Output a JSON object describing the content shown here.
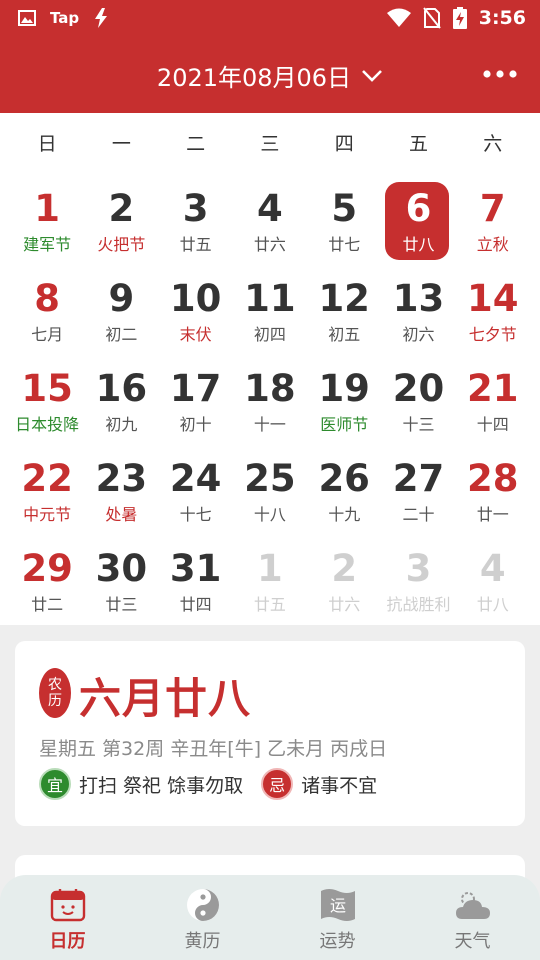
{
  "status_bar": {
    "carrier_label": "Tap",
    "time": "3:56"
  },
  "header": {
    "date_label": "2021年08月06日"
  },
  "weekdays": [
    "日",
    "一",
    "二",
    "三",
    "四",
    "五",
    "六"
  ],
  "calendar": {
    "weeks": [
      [
        {
          "day": "1",
          "sub": "建军节",
          "weekend": true,
          "sub_style": "green"
        },
        {
          "day": "2",
          "sub": "火把节",
          "weekend": false,
          "sub_style": "red"
        },
        {
          "day": "3",
          "sub": "廿五",
          "weekend": false,
          "sub_style": ""
        },
        {
          "day": "4",
          "sub": "廿六",
          "weekend": false,
          "sub_style": ""
        },
        {
          "day": "5",
          "sub": "廿七",
          "weekend": false,
          "sub_style": ""
        },
        {
          "day": "6",
          "sub": "廿八",
          "weekend": false,
          "sub_style": "",
          "selected": true
        },
        {
          "day": "7",
          "sub": "立秋",
          "weekend": true,
          "sub_style": "red"
        }
      ],
      [
        {
          "day": "8",
          "sub": "七月",
          "weekend": true,
          "sub_style": ""
        },
        {
          "day": "9",
          "sub": "初二",
          "weekend": false,
          "sub_style": ""
        },
        {
          "day": "10",
          "sub": "末伏",
          "weekend": false,
          "sub_style": "red"
        },
        {
          "day": "11",
          "sub": "初四",
          "weekend": false,
          "sub_style": ""
        },
        {
          "day": "12",
          "sub": "初五",
          "weekend": false,
          "sub_style": ""
        },
        {
          "day": "13",
          "sub": "初六",
          "weekend": false,
          "sub_style": ""
        },
        {
          "day": "14",
          "sub": "七夕节",
          "weekend": true,
          "sub_style": "red"
        }
      ],
      [
        {
          "day": "15",
          "sub": "日本投降",
          "weekend": true,
          "sub_style": "green"
        },
        {
          "day": "16",
          "sub": "初九",
          "weekend": false,
          "sub_style": ""
        },
        {
          "day": "17",
          "sub": "初十",
          "weekend": false,
          "sub_style": ""
        },
        {
          "day": "18",
          "sub": "十一",
          "weekend": false,
          "sub_style": ""
        },
        {
          "day": "19",
          "sub": "医师节",
          "weekend": false,
          "sub_style": "green"
        },
        {
          "day": "20",
          "sub": "十三",
          "weekend": false,
          "sub_style": ""
        },
        {
          "day": "21",
          "sub": "十四",
          "weekend": true,
          "sub_style": ""
        }
      ],
      [
        {
          "day": "22",
          "sub": "中元节",
          "weekend": true,
          "sub_style": "red"
        },
        {
          "day": "23",
          "sub": "处暑",
          "weekend": false,
          "sub_style": "red"
        },
        {
          "day": "24",
          "sub": "十七",
          "weekend": false,
          "sub_style": ""
        },
        {
          "day": "25",
          "sub": "十八",
          "weekend": false,
          "sub_style": ""
        },
        {
          "day": "26",
          "sub": "十九",
          "weekend": false,
          "sub_style": ""
        },
        {
          "day": "27",
          "sub": "二十",
          "weekend": false,
          "sub_style": ""
        },
        {
          "day": "28",
          "sub": "廿一",
          "weekend": true,
          "sub_style": ""
        }
      ],
      [
        {
          "day": "29",
          "sub": "廿二",
          "weekend": true,
          "sub_style": ""
        },
        {
          "day": "30",
          "sub": "廿三",
          "weekend": false,
          "sub_style": ""
        },
        {
          "day": "31",
          "sub": "廿四",
          "weekend": false,
          "sub_style": ""
        },
        {
          "day": "1",
          "sub": "廿五",
          "weekend": false,
          "sub_style": "",
          "faded": true
        },
        {
          "day": "2",
          "sub": "廿六",
          "weekend": false,
          "sub_style": "",
          "faded": true
        },
        {
          "day": "3",
          "sub": "抗战胜利",
          "weekend": false,
          "sub_style": "",
          "faded": true
        },
        {
          "day": "4",
          "sub": "廿八",
          "weekend": true,
          "sub_style": "",
          "faded": true
        }
      ]
    ]
  },
  "day_info": {
    "seal_text": [
      "农",
      "历"
    ],
    "lunar_date": "六月廿八",
    "ganzhi": "星期五 第32周 辛丑年[牛] 乙未月 丙戌日",
    "yi_badge": "宜",
    "yi_text": "打扫 祭祀 馀事勿取",
    "ji_badge": "忌",
    "ji_text": "诸事不宜"
  },
  "bottom_nav": [
    {
      "label": "日历",
      "icon": "calendar-icon",
      "active": true
    },
    {
      "label": "黄历",
      "icon": "yin-yang-icon",
      "active": false
    },
    {
      "label": "运势",
      "icon": "fortune-flag-icon",
      "icon_text": "运",
      "active": false
    },
    {
      "label": "天气",
      "icon": "weather-cloud-icon",
      "active": false
    }
  ],
  "colors": {
    "primary": "#c62f2f",
    "festival_green": "#2e8b2e",
    "faded": "#cfcfcf"
  }
}
